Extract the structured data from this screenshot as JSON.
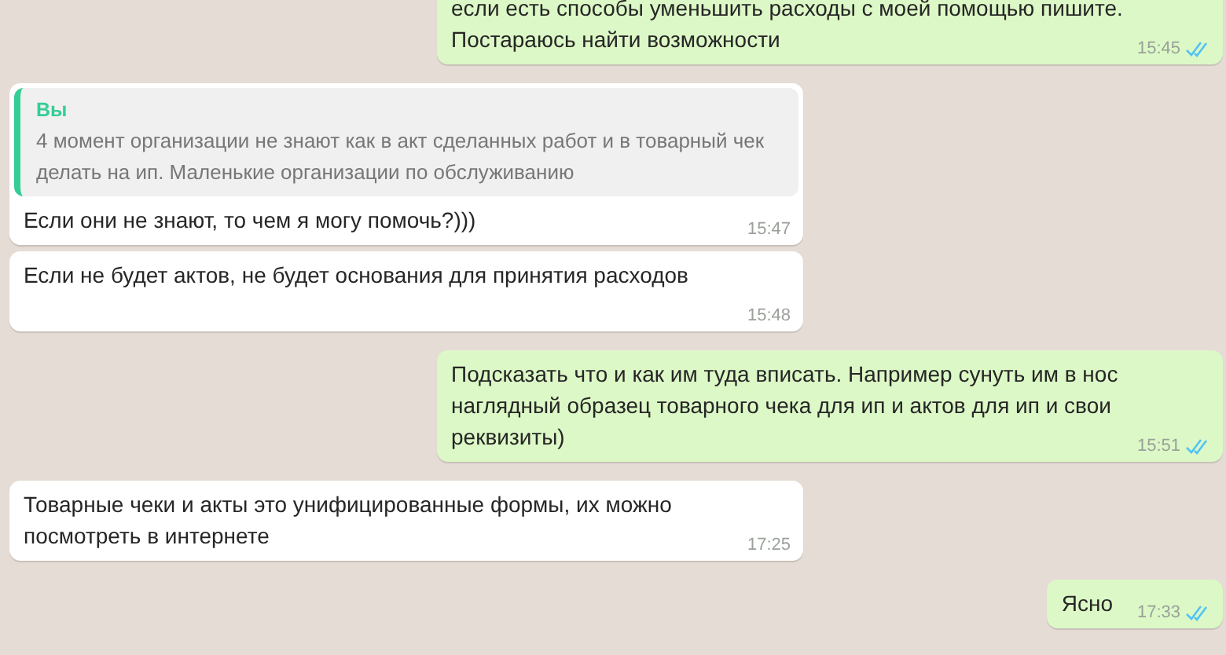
{
  "messages": [
    {
      "kind": "out",
      "text": "если есть способы уменьшить расходы с моей помощью пишите. Постараюсь найти возможности",
      "time": "15:45",
      "read": true
    },
    {
      "kind": "in",
      "quote": {
        "author": "Вы",
        "text": "4 момент организации не знают как в акт сделанных работ и в товарный чек делать на ип. Маленькие организации по обслуживанию"
      },
      "text": "Если они не знают, то чем я могу помочь?)))",
      "time": "15:47"
    },
    {
      "kind": "in",
      "text": "Если не будет актов, не будет основания для принятия расходов",
      "time": "15:48"
    },
    {
      "kind": "out",
      "text": "Подсказать что и как им туда вписать. Например сунуть им в нос наглядный образец товарного чека для ип и актов для ип и свои реквизиты)",
      "time": "15:51",
      "read": true
    },
    {
      "kind": "in",
      "text": "Товарные чеки и акты это унифицированные формы, их можно посмотреть в интернете",
      "time": "17:25"
    },
    {
      "kind": "out",
      "text": "Ясно",
      "time": "17:33",
      "read": true
    }
  ]
}
